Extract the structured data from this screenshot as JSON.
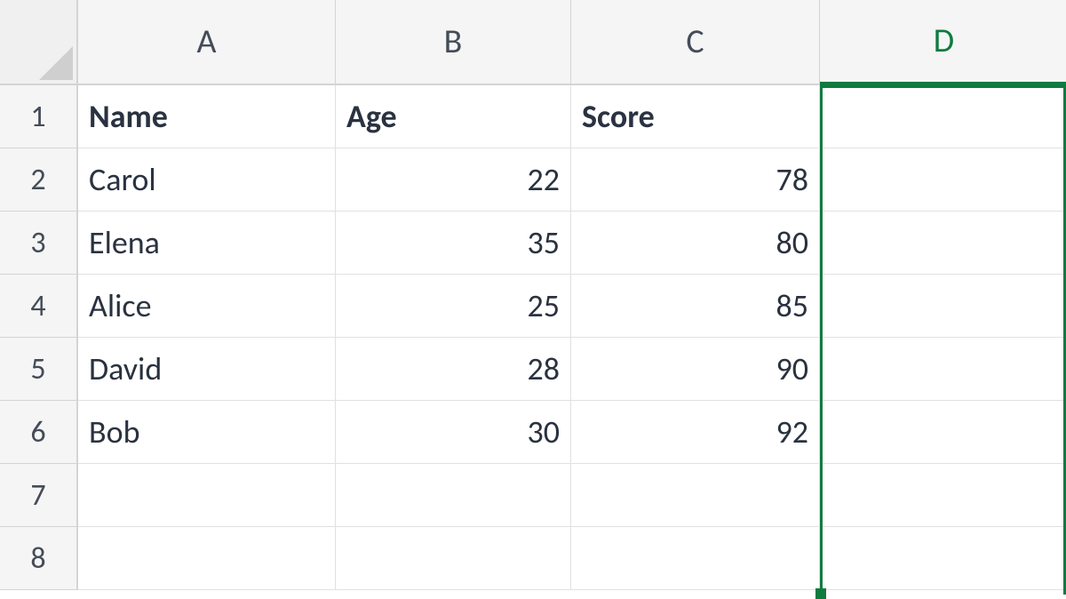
{
  "columns": [
    "A",
    "B",
    "C",
    "D"
  ],
  "row_numbers": [
    "1",
    "2",
    "3",
    "4",
    "5",
    "6",
    "7",
    "8"
  ],
  "headers": {
    "A": "Name",
    "B": "Age",
    "C": "Score"
  },
  "rows": [
    {
      "A": "Carol",
      "B": "22",
      "C": "78"
    },
    {
      "A": "Elena",
      "B": "35",
      "C": "80"
    },
    {
      "A": "Alice",
      "B": "25",
      "C": "85"
    },
    {
      "A": "David",
      "B": "28",
      "C": "90"
    },
    {
      "A": "Bob",
      "B": "30",
      "C": "92"
    }
  ],
  "selected_column": "D",
  "chart_data": {
    "type": "table",
    "columns": [
      "Name",
      "Age",
      "Score"
    ],
    "rows": [
      [
        "Carol",
        22,
        78
      ],
      [
        "Elena",
        35,
        80
      ],
      [
        "Alice",
        25,
        85
      ],
      [
        "David",
        28,
        90
      ],
      [
        "Bob",
        30,
        92
      ]
    ]
  }
}
